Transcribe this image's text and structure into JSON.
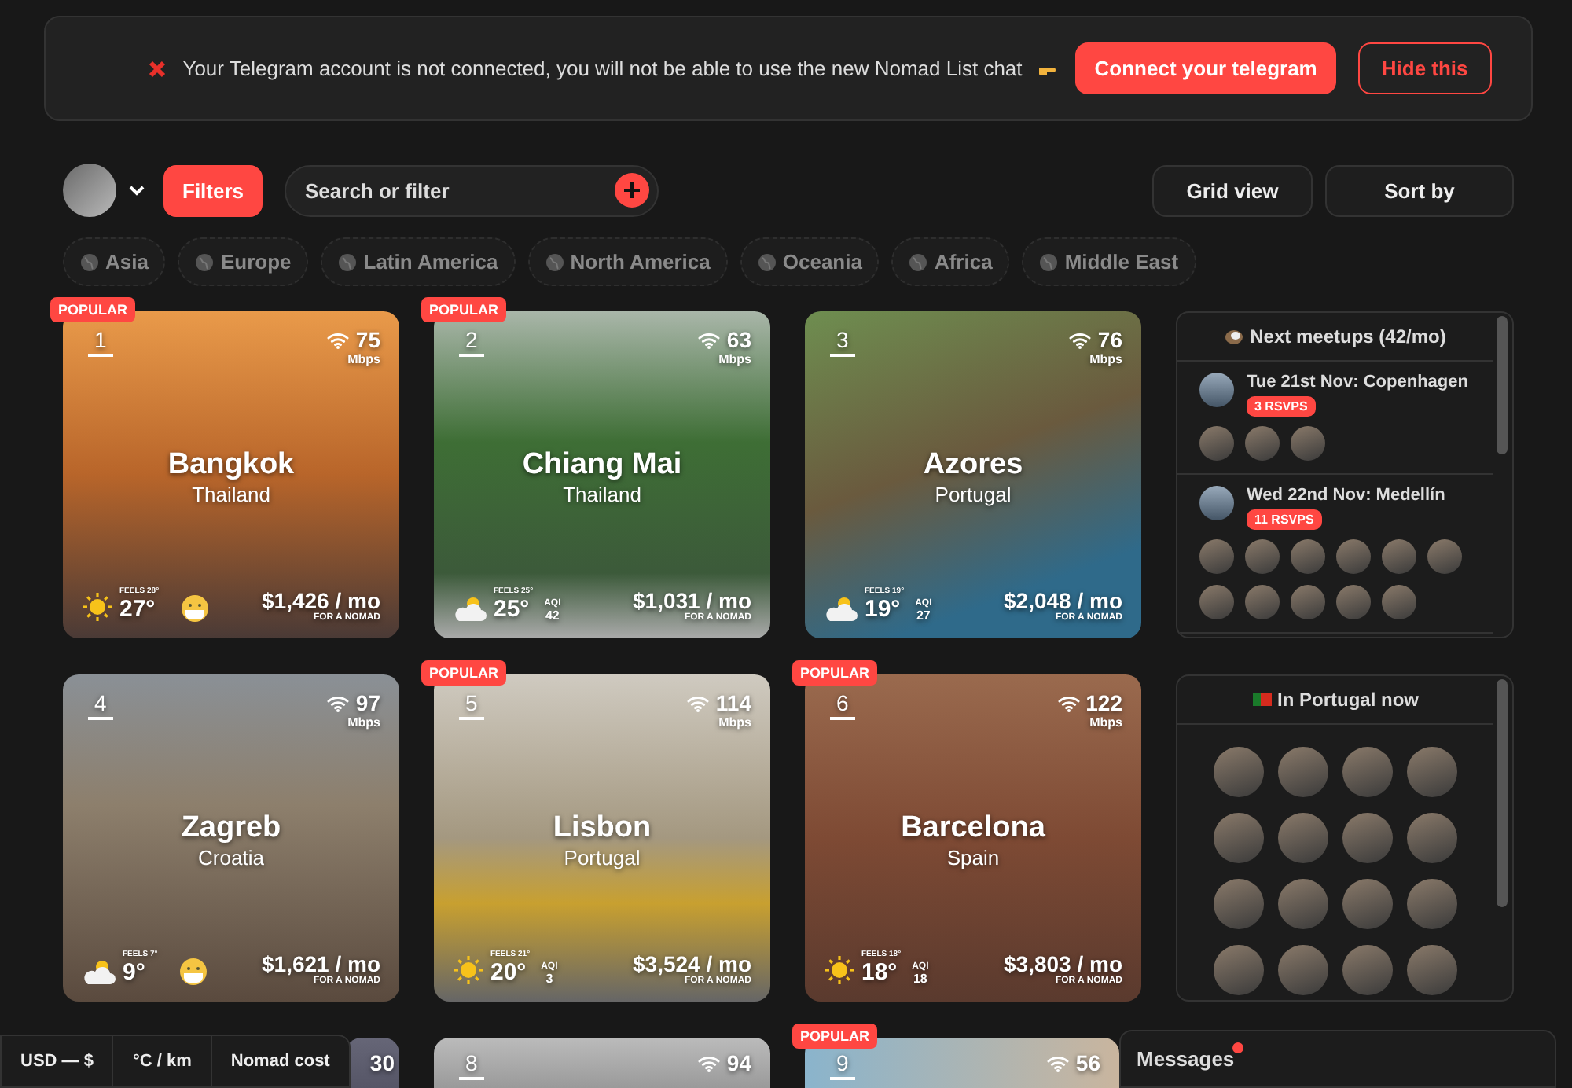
{
  "banner": {
    "message": "Your Telegram account is not connected, you will not be able to use the new Nomad List chat",
    "connect_button": "Connect your telegram",
    "hide_button": "Hide this"
  },
  "toolbar": {
    "filters_button": "Filters",
    "search": {
      "placeholder": "Search or filter"
    },
    "view_button": "Grid view",
    "sort_button": "Sort by"
  },
  "regions": [
    {
      "label": "Asia"
    },
    {
      "label": "Europe"
    },
    {
      "label": "Latin America"
    },
    {
      "label": "North America"
    },
    {
      "label": "Oceania"
    },
    {
      "label": "Africa"
    },
    {
      "label": "Middle East"
    }
  ],
  "cities": [
    {
      "rank": "1",
      "popular_badge": "POPULAR",
      "speed": "75",
      "speed_unit": "Mbps",
      "name": "Bangkok",
      "country": "Thailand",
      "weather": {
        "kind": "sunny"
      },
      "feels": "FEELS 28°",
      "temp": "27°",
      "aqi": {
        "kind": "mask"
      },
      "cost": "$1,426 / mo",
      "cost_note": "FOR A NOMAD"
    },
    {
      "rank": "2",
      "popular_badge": "POPULAR",
      "speed": "63",
      "speed_unit": "Mbps",
      "name": "Chiang Mai",
      "country": "Thailand",
      "weather": {
        "kind": "cloudy"
      },
      "feels": "FEELS 25°",
      "temp": "25°",
      "aqi": {
        "kind": "value",
        "label": "AQI",
        "value": "42"
      },
      "cost": "$1,031 / mo",
      "cost_note": "FOR A NOMAD"
    },
    {
      "rank": "3",
      "speed": "76",
      "speed_unit": "Mbps",
      "name": "Azores",
      "country": "Portugal",
      "weather": {
        "kind": "cloudy"
      },
      "feels": "FEELS 19°",
      "temp": "19°",
      "aqi": {
        "kind": "value",
        "label": "AQI",
        "value": "27"
      },
      "cost": "$2,048 / mo",
      "cost_note": "FOR A NOMAD"
    },
    {
      "rank": "4",
      "speed": "97",
      "speed_unit": "Mbps",
      "name": "Zagreb",
      "country": "Croatia",
      "weather": {
        "kind": "cloudy"
      },
      "feels": "FEELS 7°",
      "temp": "9°",
      "aqi": {
        "kind": "mask"
      },
      "cost": "$1,621 / mo",
      "cost_note": "FOR A NOMAD"
    },
    {
      "rank": "5",
      "popular_badge": "POPULAR",
      "speed": "114",
      "speed_unit": "Mbps",
      "name": "Lisbon",
      "country": "Portugal",
      "weather": {
        "kind": "sunny"
      },
      "feels": "FEELS 21°",
      "temp": "20°",
      "aqi": {
        "kind": "value",
        "label": "AQI",
        "value": "3"
      },
      "cost": "$3,524 / mo",
      "cost_note": "FOR A NOMAD"
    },
    {
      "rank": "6",
      "popular_badge": "POPULAR",
      "speed": "122",
      "speed_unit": "Mbps",
      "name": "Barcelona",
      "country": "Spain",
      "weather": {
        "kind": "sunny"
      },
      "feels": "FEELS 18°",
      "temp": "18°",
      "aqi": {
        "kind": "value",
        "label": "AQI",
        "value": "18"
      },
      "cost": "$3,803 / mo",
      "cost_note": "FOR A NOMAD"
    }
  ],
  "more_cities": [
    {
      "speed": "30"
    },
    {
      "rank": "8",
      "speed": "94"
    },
    {
      "rank": "9",
      "speed": "56",
      "popular_badge": "POPULAR"
    }
  ],
  "meetups": {
    "title": "Next meetups (42/mo)",
    "events": [
      {
        "title": "Tue 21st Nov: Copenhagen",
        "rsvps": "3 RSVPS"
      },
      {
        "title": "Wed 22nd Nov: Medellín",
        "rsvps": "11 RSVPS"
      }
    ]
  },
  "locals": {
    "title": "In Portugal now"
  },
  "footer": {
    "currency": "USD — $",
    "units": "°C / km",
    "cost_mode": "Nomad cost"
  },
  "messages": {
    "title": "Messages",
    "unread": true
  }
}
